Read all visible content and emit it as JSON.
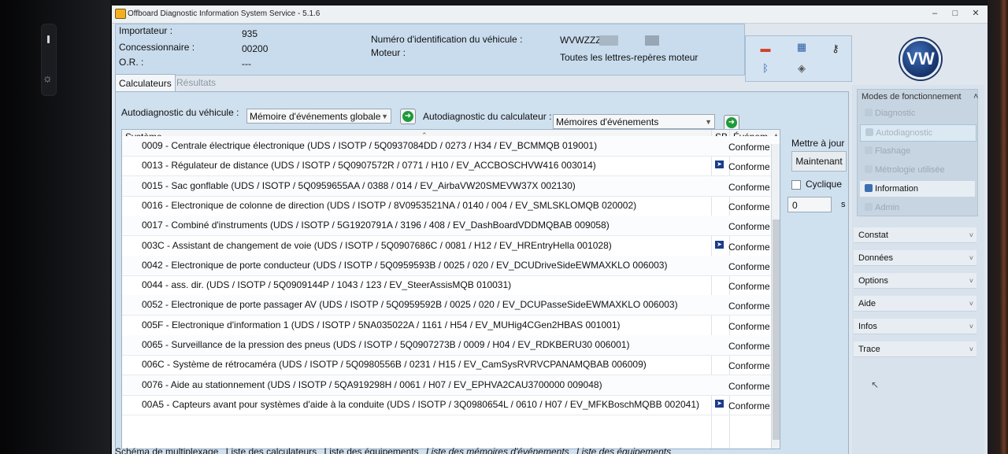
{
  "window": {
    "title": "Offboard Diagnostic Information System Service - 5.1.6",
    "controls": [
      "–",
      "□",
      "✕"
    ]
  },
  "header": {
    "importateur_label": "Importateur :",
    "importateur_value": "935",
    "concessionnaire_label": "Concessionnaire :",
    "concessionnaire_value": "00200",
    "or_label": "O.R. :",
    "or_value": "---",
    "vin_label": "Numéro d'identification du véhicule :",
    "vin_value": "WVWZZZ",
    "moteur_label": "Moteur :",
    "moteur_value": "Toutes les lettres-repères moteur",
    "logo_text": "VW"
  },
  "tabs": {
    "calculateurs": "Calculateurs",
    "resultats": "Résultats"
  },
  "toolbar": {
    "vehicle_label": "Autodiagnostic du véhicule :",
    "vehicle_select": "Mémoire d'événements globale",
    "ecu_label": "Autodiagnostic du calculateur :",
    "ecu_select": "Mémoires d'événements"
  },
  "table": {
    "headers": {
      "system": "Système",
      "sb": "SB",
      "event": "Événem..."
    },
    "rows": [
      {
        "system": "0009 - Centrale électrique électronique  (UDS / ISOTP / 5Q0937084DD / 0273 / H34 / EV_BCMMQB 019001)",
        "sb": false,
        "event": "Conforme"
      },
      {
        "system": "0013 - Régulateur de distance  (UDS / ISOTP / 5Q0907572R / 0771 / H10 / EV_ACCBOSCHVW416 003014)",
        "sb": true,
        "event": "Conforme"
      },
      {
        "system": "0015 - Sac gonflable  (UDS / ISOTP / 5Q0959655AA / 0388 / 014 / EV_AirbaVW20SMEVW37X 002130)",
        "sb": false,
        "event": "Conforme"
      },
      {
        "system": "0016 - Electronique de colonne de direction  (UDS / ISOTP / 8V0953521NA / 0140 / 004 / EV_SMLSKLOMQB 020002)",
        "sb": false,
        "event": "Conforme"
      },
      {
        "system": "0017 - Combiné d'instruments  (UDS / ISOTP / 5G1920791A / 3196 / 408 / EV_DashBoardVDDMQBAB 009058)",
        "sb": false,
        "event": "Conforme"
      },
      {
        "system": "003C - Assistant de changement de voie  (UDS / ISOTP / 5Q0907686C / 0081 / H12 / EV_HREntryHella 001028)",
        "sb": true,
        "event": "Conforme"
      },
      {
        "system": "0042 - Electronique de porte conducteur  (UDS / ISOTP / 5Q0959593B / 0025 / 020 / EV_DCUDriveSideEWMAXKLO 006003)",
        "sb": false,
        "event": "Conforme"
      },
      {
        "system": "0044 - ass. dir.  (UDS / ISOTP / 5Q0909144P / 1043 / 123 / EV_SteerAssisMQB 010031)",
        "sb": false,
        "event": "Conforme"
      },
      {
        "system": "0052 - Electronique de porte passager AV  (UDS / ISOTP / 5Q0959592B / 0025 / 020 / EV_DCUPasseSideEWMAXKLO 006003)",
        "sb": false,
        "event": "Conforme"
      },
      {
        "system": "005F - Electronique d'information 1  (UDS / ISOTP / 5NA035022A / 1161 / H54 / EV_MUHig4CGen2HBAS 001001)",
        "sb": false,
        "event": "Conforme"
      },
      {
        "system": "0065 - Surveillance de la pression des pneus  (UDS / ISOTP / 5Q0907273B / 0009 / H04 / EV_RDKBERU30 006001)",
        "sb": false,
        "event": "Conforme"
      },
      {
        "system": "006C - Système de rétrocaméra  (UDS / ISOTP / 5Q0980556B / 0231 / H15 / EV_CamSysRVRVCPANAMQBAB 006009)",
        "sb": false,
        "event": "Conforme"
      },
      {
        "system": "0076 - Aide au stationnement  (UDS / ISOTP / 5QA919298H / 0061 / H07 / EV_EPHVA2CAU3700000 009048)",
        "sb": false,
        "event": "Conforme"
      },
      {
        "system": "00A5 - Capteurs avant pour systèmes d'aide à la conduite  (UDS / ISOTP / 3Q0980654L / 0610 / H07 / EV_MFKBoschMQBB 002041)",
        "sb": true,
        "event": "Conforme"
      }
    ]
  },
  "refresh": {
    "label": "Mettre à jour",
    "now_button": "Maintenant",
    "cyclic_label": "Cyclique",
    "interval_value": "0",
    "unit": "s"
  },
  "bottom_tabs": [
    "Schéma de multiplexage",
    "Liste des calculateurs",
    "Liste des équipements",
    "Liste des mémoires d'événements",
    "Liste des équipements"
  ],
  "sidebar": {
    "modes_title": "Modes de fonctionnement",
    "modes": [
      "Diagnostic",
      "Autodiagnostic",
      "Flashage",
      "Métrologie utilisée",
      "Information",
      "Admin"
    ],
    "sections": [
      "Constat",
      "Données",
      "Options",
      "Aide",
      "Infos",
      "Trace"
    ]
  }
}
